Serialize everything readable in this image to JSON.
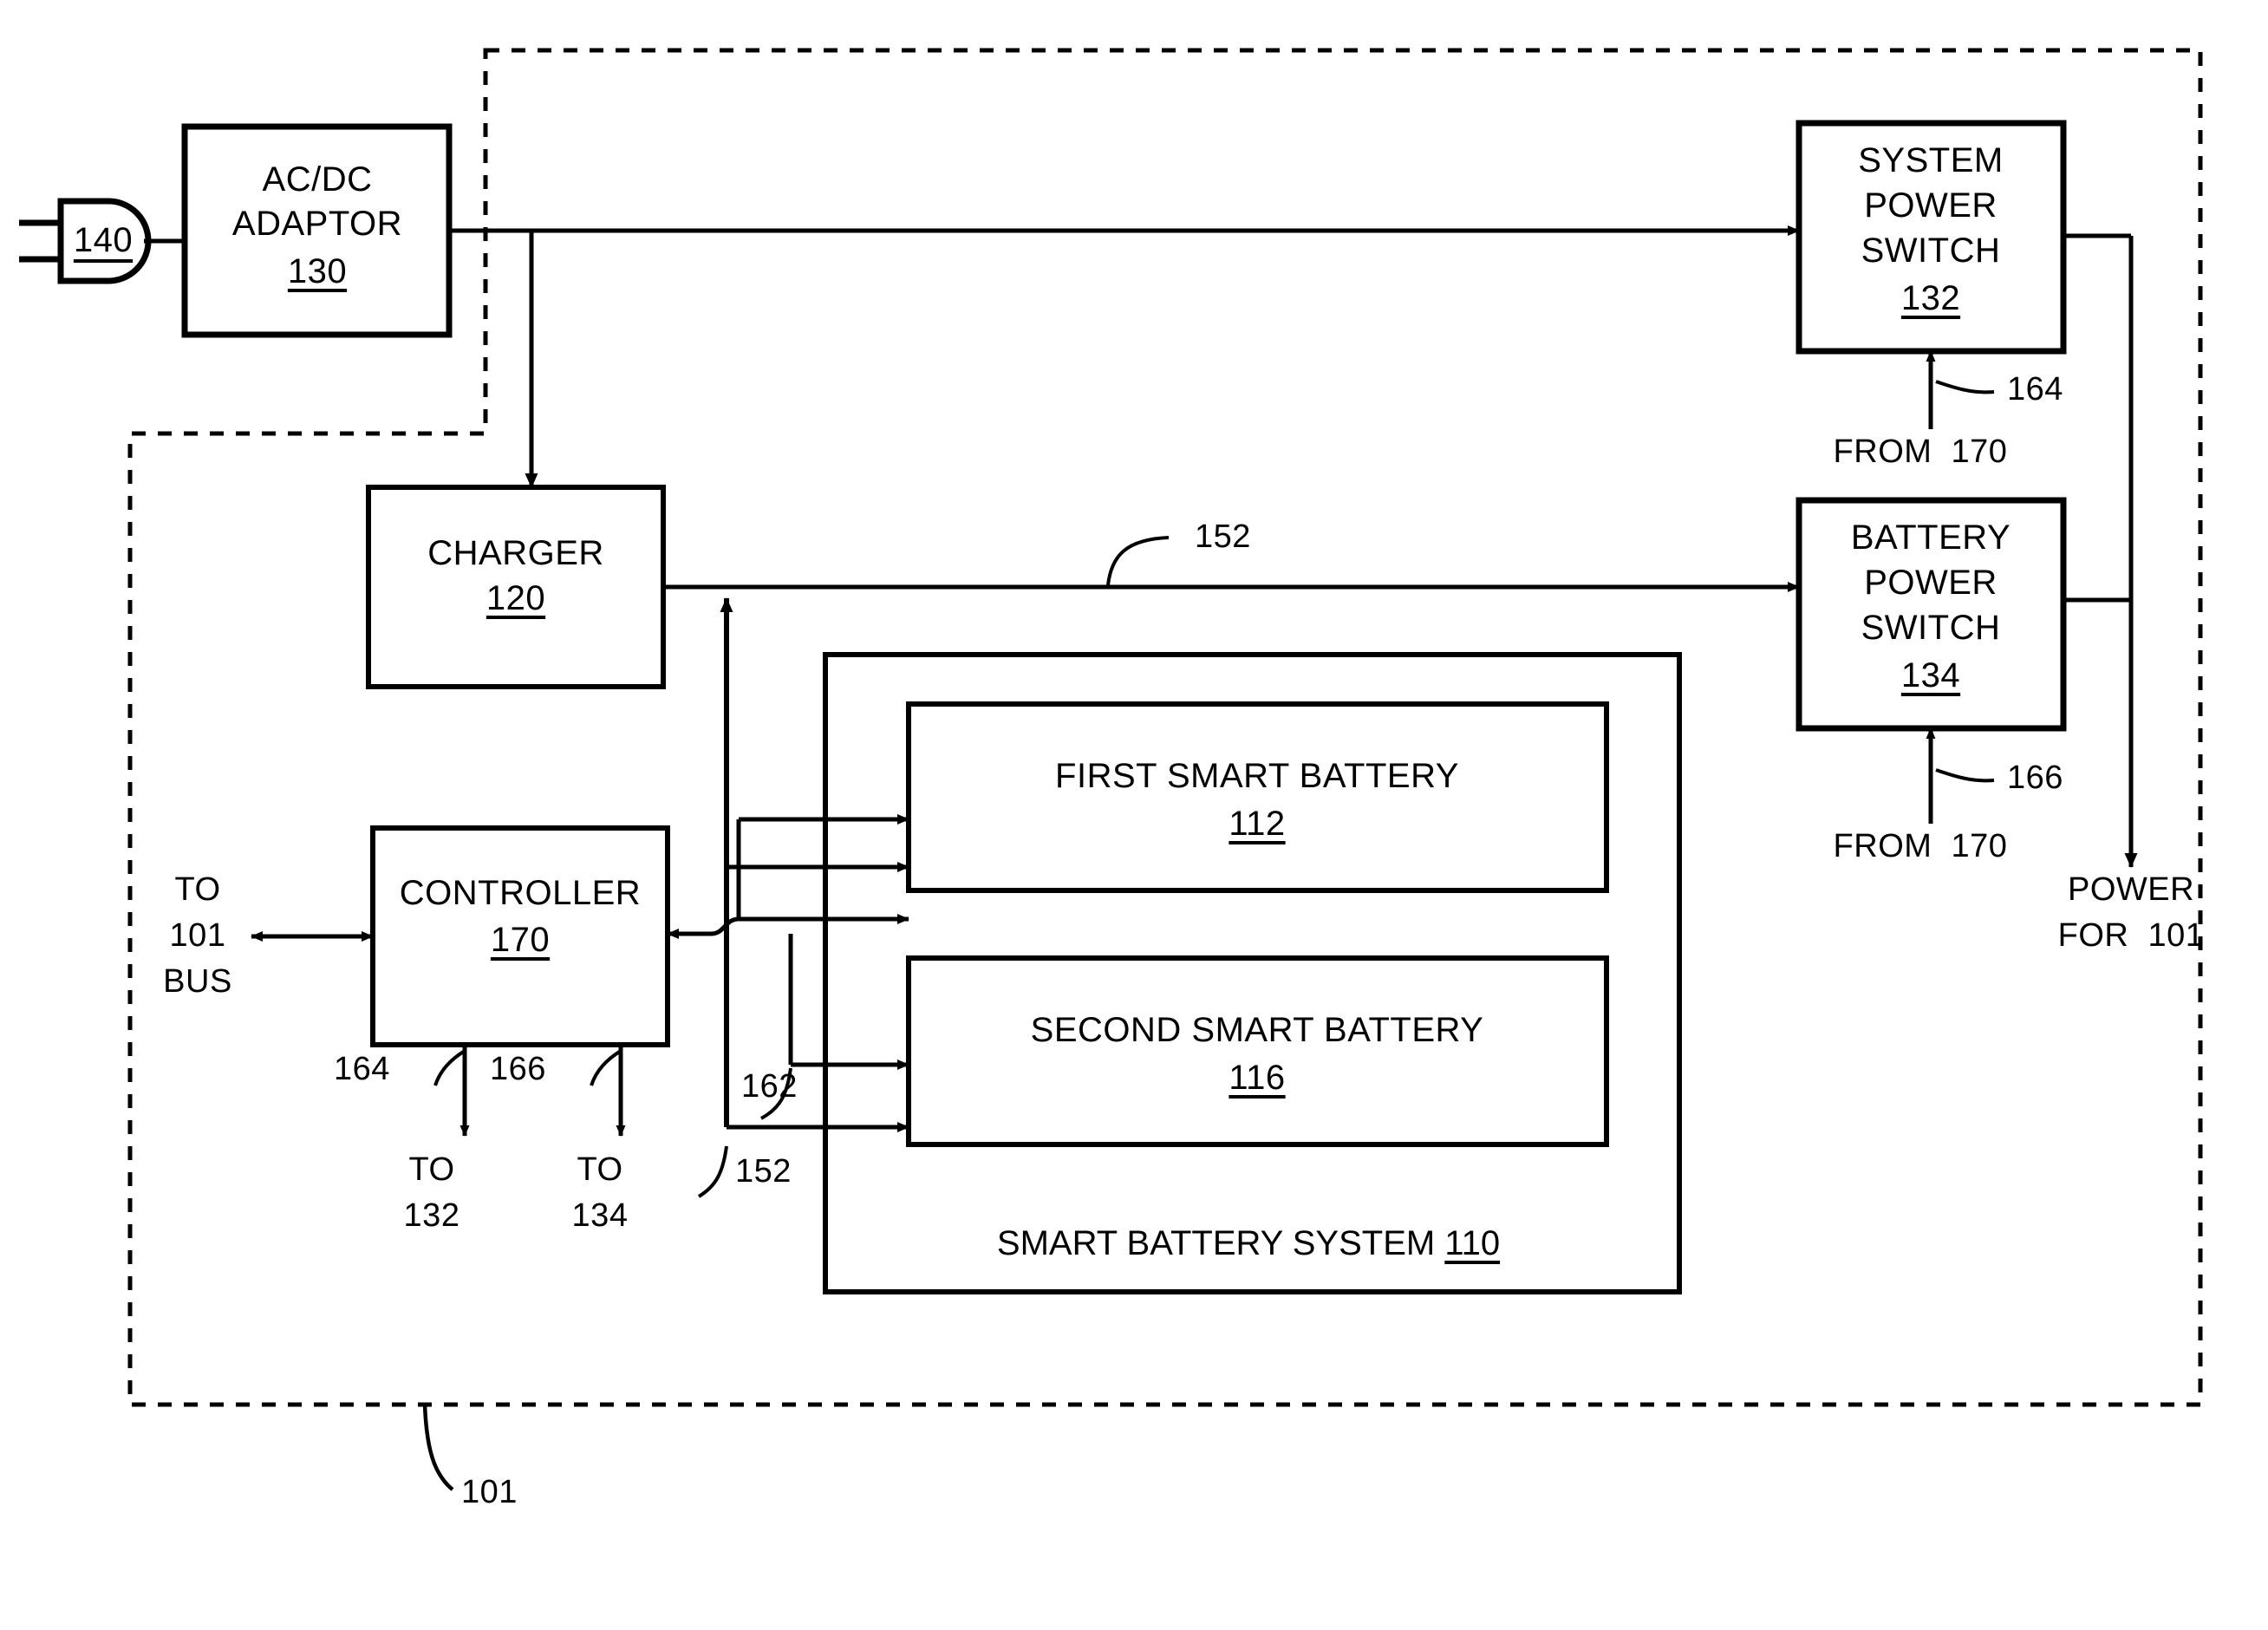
{
  "figure": {
    "type": "patent-block-diagram",
    "description": "Smart battery power management block diagram"
  },
  "blocks": {
    "plug": {
      "ref": "140"
    },
    "adaptor": {
      "title_line1": "AC/DC",
      "title_line2": "ADAPTOR",
      "ref": "130"
    },
    "charger": {
      "title": "CHARGER",
      "ref": "120"
    },
    "controller": {
      "title": "CONTROLLER",
      "ref": "170"
    },
    "system_power_switch": {
      "line1": "SYSTEM",
      "line2": "POWER",
      "line3": "SWITCH",
      "ref": "132"
    },
    "battery_power_switch": {
      "line1": "BATTERY",
      "line2": "POWER",
      "line3": "SWITCH",
      "ref": "134"
    },
    "first_battery": {
      "title": "FIRST SMART BATTERY",
      "ref": "112"
    },
    "second_battery": {
      "title": "SECOND SMART BATTERY",
      "ref": "116"
    },
    "battery_system": {
      "title": "SMART BATTERY SYSTEM",
      "ref": "110"
    }
  },
  "labels": {
    "to_101_bus_line1": "TO",
    "to_101_bus_line2": "101",
    "to_101_bus_line3": "BUS",
    "from_170_top": "FROM  170",
    "from_170_bottom": "FROM  170",
    "power_for_101_line1": "POWER",
    "power_for_101_line2": "FOR  101",
    "to_132_line1": "TO",
    "to_132_line2": "132",
    "to_134_line1": "TO",
    "to_134_line2": "134"
  },
  "reference_numerals": {
    "bus_152_top": "152",
    "bus_152_bottom": "152",
    "bus_162": "162",
    "signal_164_switch": "164",
    "signal_166_switch": "166",
    "signal_164_controller": "164",
    "signal_166_controller": "166",
    "system_101": "101"
  },
  "colors": {
    "stroke": "#000000",
    "background": "#ffffff"
  }
}
